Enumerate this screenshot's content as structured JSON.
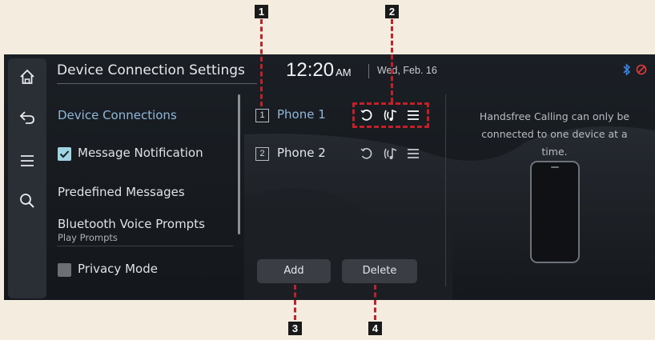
{
  "callouts": [
    "1",
    "2",
    "3",
    "4"
  ],
  "header": {
    "title": "Device Connection Settings",
    "time": "12:20",
    "ampm": "AM",
    "date": "Wed, Feb. 16"
  },
  "rail": {
    "icons": [
      "home-icon",
      "back-icon",
      "menu-icon",
      "search-icon"
    ]
  },
  "menu": {
    "device_connections": "Device Connections",
    "message_notification": "Message Notification",
    "predefined_messages": "Predefined Messages",
    "bluetooth_voice_prompts": "Bluetooth Voice Prompts",
    "bluetooth_voice_prompts_sub": "Play Prompts",
    "privacy_mode": "Privacy Mode",
    "message_notification_checked": true,
    "privacy_mode_checked": false
  },
  "devices": [
    {
      "num": "1",
      "name": "Phone 1",
      "active": true
    },
    {
      "num": "2",
      "name": "Phone 2",
      "active": false
    }
  ],
  "buttons": {
    "add": "Add",
    "delete": "Delete"
  },
  "info": {
    "text": "Handsfree Calling can only be connected to one device at a time."
  },
  "colors": {
    "accent_blue": "#8fb7d9",
    "callout_dash": "#c4202a",
    "status_bluetooth": "#3b7fe0",
    "status_red": "#e23b3b"
  }
}
